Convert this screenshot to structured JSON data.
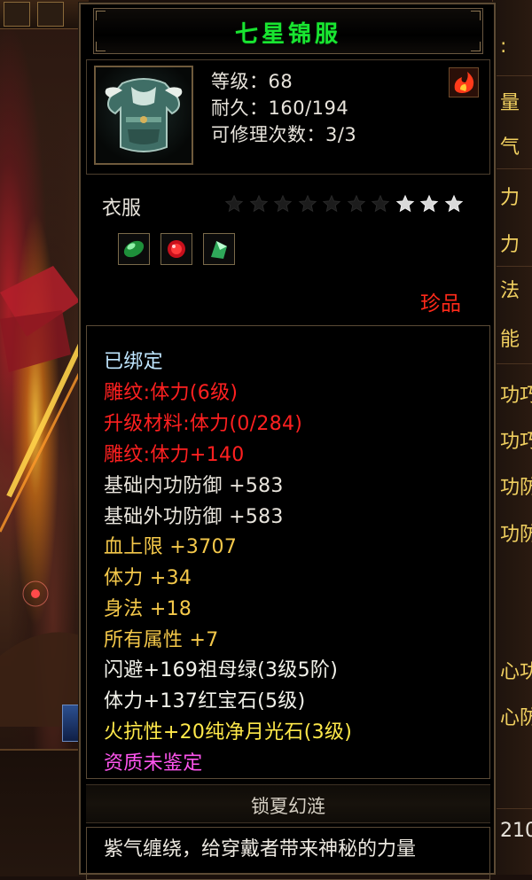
{
  "item": {
    "name": "七星锦服",
    "level": "等级：68",
    "durability": "耐久：160/194",
    "repair": "可修理次数：3/3",
    "type": "衣服",
    "stars_total": 10,
    "stars_lit": 3,
    "rarity": "珍品",
    "set_name": "锁夏幻涟",
    "description": "紫气缠绕，给穿戴者带来神秘的力量"
  },
  "gems": [
    "emerald-gem-icon",
    "ruby-gem-icon",
    "moonstone-gem-icon"
  ],
  "properties": [
    {
      "text": "已绑定",
      "color": "#bfe6ff"
    },
    {
      "text": "雕纹:体力(6级)",
      "color": "#ff2020"
    },
    {
      "text": "升级材料:体力(0/284)",
      "color": "#ff2020"
    },
    {
      "text": "雕纹:体力+140",
      "color": "#ff2020"
    },
    {
      "text": "基础内功防御 +583",
      "color": "#e8e4dc"
    },
    {
      "text": "基础外功防御 +583",
      "color": "#e8e4dc"
    },
    {
      "text": "血上限 +3707",
      "color": "#f4c84a"
    },
    {
      "text": "体力 +34",
      "color": "#f4c84a"
    },
    {
      "text": "身法 +18",
      "color": "#f4c84a"
    },
    {
      "text": "所有属性 +7",
      "color": "#f4c84a"
    },
    {
      "text": "闪避+169祖母绿(3级5阶)",
      "color": "#f2f2ea"
    },
    {
      "text": "体力+137红宝石(5级)",
      "color": "#f2f2ea"
    },
    {
      "text": "火抗性+20纯净月光石(3级)",
      "color": "#ffe94a"
    },
    {
      "text": "资质未鉴定",
      "color": "#ff55ee"
    }
  ],
  "side_panel": {
    "labels": [
      ":",
      "量",
      "气",
      "力",
      "力",
      "法",
      "能",
      "功巧",
      "功巧",
      "功防",
      "功防",
      "心功",
      "心防",
      "210"
    ]
  }
}
